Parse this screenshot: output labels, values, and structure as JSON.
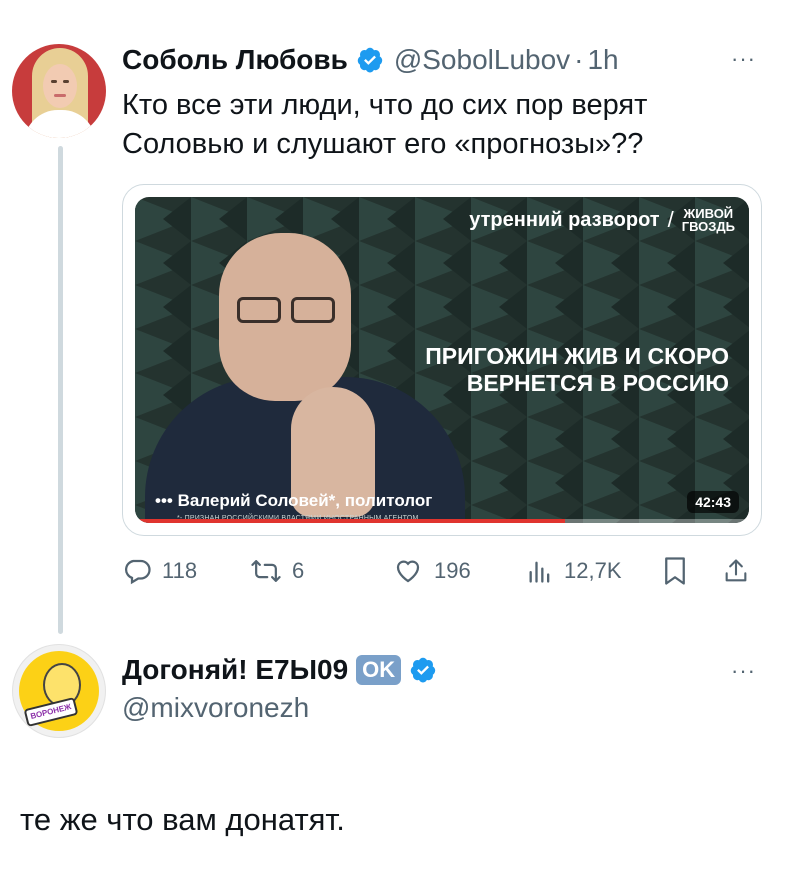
{
  "tweet": {
    "author_name": "Соболь Любовь",
    "handle": "@SobolLubov",
    "separator": "·",
    "time": "1h",
    "more": "···",
    "text": "Кто все эти люди, что до сих пор верят Соловью и слушают его «прогнозы»??",
    "media": {
      "show_title": "утренний разворот",
      "show_slash": "/",
      "brand_line1": "ЖИВОЙ",
      "brand_line2": "ГВОЗДЬ",
      "headline": "ПРИГОЖИН ЖИВ И СКОРО ВЕРНЕТСЯ В РОССИЮ",
      "caption": "••• Валерий Соловей*, политолог",
      "caption_note": "*- ПРИЗНАН РОССИЙСКИМИ ВЛАСТЯМИ ИНОСТРАННЫМ АГЕНТОМ",
      "duration": "42:43",
      "progress_fraction": 0.7
    },
    "actions": {
      "replies": "118",
      "retweets": "6",
      "likes": "196",
      "views": "12,7K"
    }
  },
  "reply": {
    "author_name": "Догоняй! Е7Ы09",
    "ok_badge": "OK",
    "handle": "@mixvoronezh",
    "more": "···",
    "avatar_badge": "ВОРОНЕЖ",
    "text": "те же что вам донатят."
  },
  "colors": {
    "verified": "#1d9bf0",
    "muted": "#536471",
    "progress": "#e0342e"
  }
}
